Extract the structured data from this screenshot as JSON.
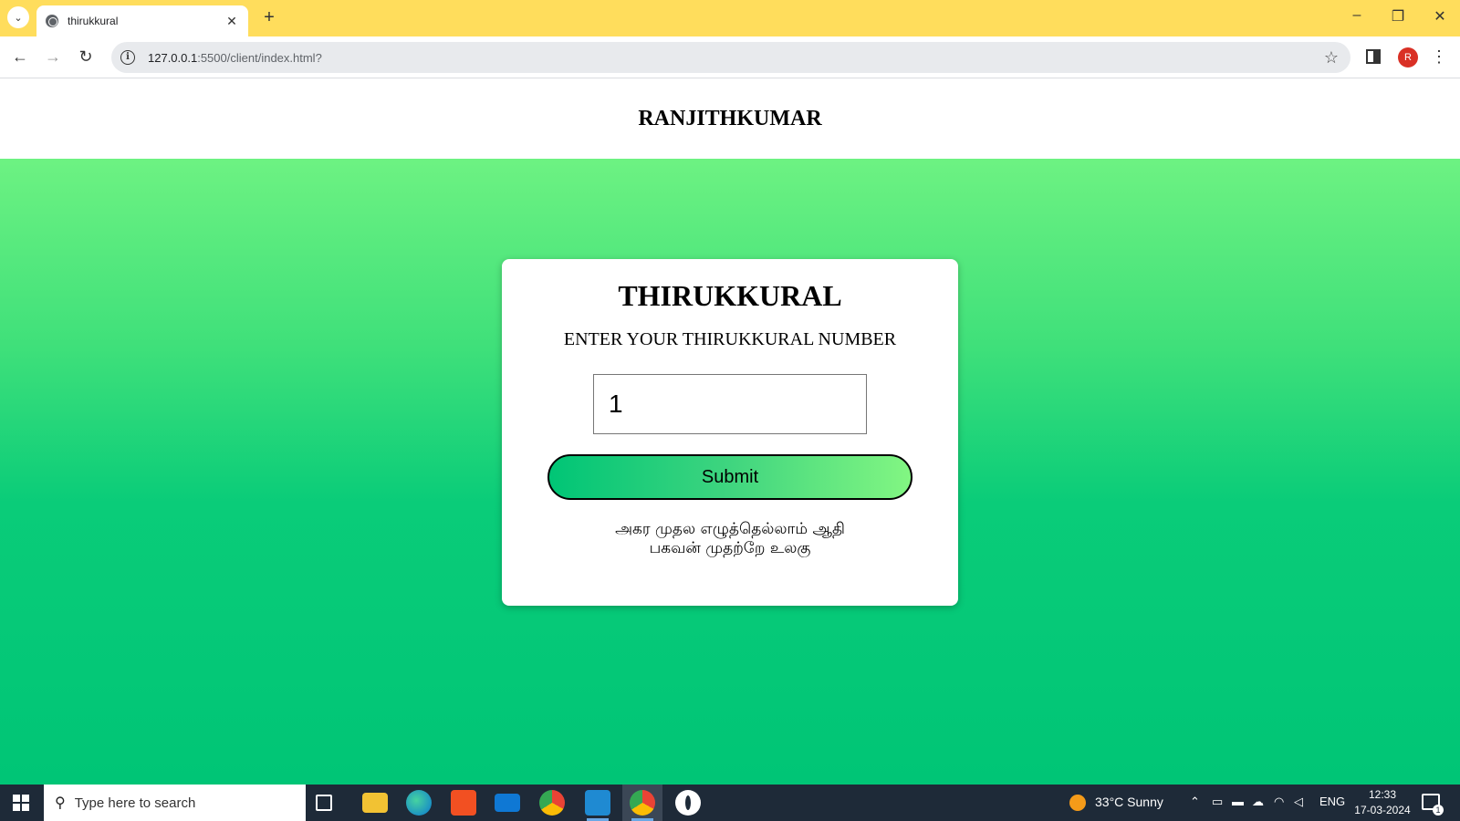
{
  "browser": {
    "tab_title": "thirukkural",
    "url_host": "127.0.0.1",
    "url_path": ":5500/client/index.html?"
  },
  "page": {
    "header_title": "RANJITHKUMAR",
    "card_title": "THIRUKKURAL",
    "prompt_label": "ENTER YOUR THIRUKKURAL NUMBER",
    "input_value": "1",
    "submit_label": "Submit",
    "kural_line1": "அகர முதல எழுத்தெல்லாம் ஆதி",
    "kural_line2": "பகவன் முதற்றே உலகு"
  },
  "taskbar": {
    "search_placeholder": "Type here to search",
    "weather": "33°C  Sunny",
    "language": "ENG",
    "time": "12:33",
    "date": "17-03-2024",
    "notification_count": "1"
  },
  "colors": {
    "tab_strip": "#ffdd5c",
    "background_top": "#6df282",
    "background_bottom": "#00c576",
    "taskbar": "#1e2a38"
  }
}
